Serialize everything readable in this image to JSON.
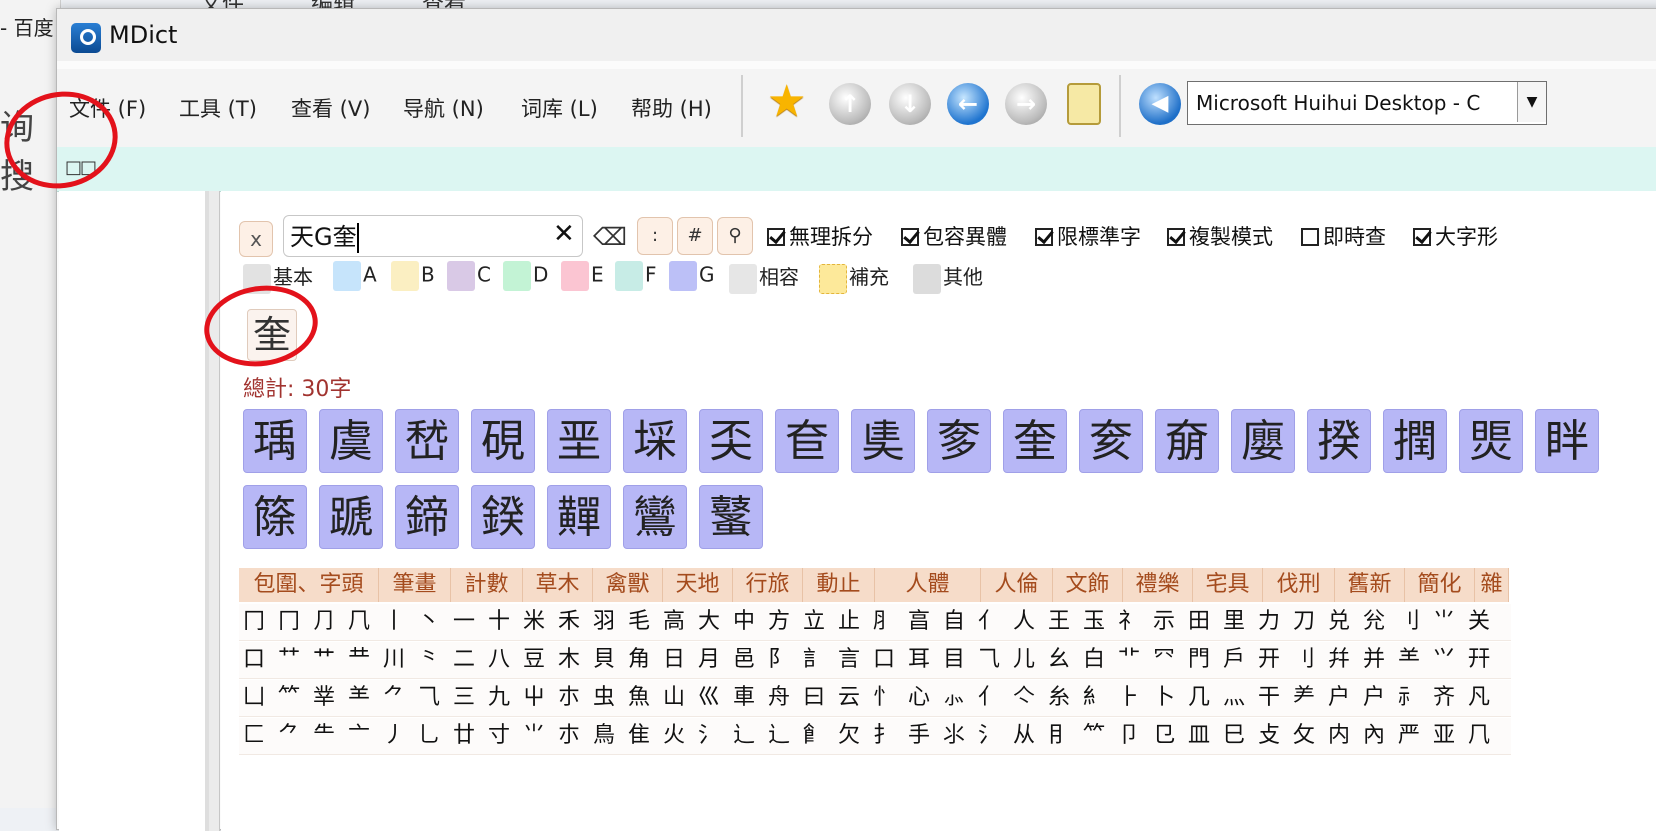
{
  "background": {
    "left_text_1": "- 百度",
    "left_text_2": "询搜",
    "menu": [
      "文件",
      "编辑",
      "查看"
    ]
  },
  "window": {
    "title": "MDict",
    "menu": [
      "文件 (F)",
      "工具 (T)",
      "查看 (V)",
      "导航 (N)",
      "词库 (L)",
      "帮助 (H)"
    ],
    "toolbar": {
      "buttons": [
        "star-icon",
        "up-icon",
        "down-icon",
        "back-icon",
        "forward-icon",
        "clipboard-icon",
        "speaker-icon"
      ],
      "dictionary": "Microsoft Huihui Desktop - C"
    },
    "address": "□□"
  },
  "search": {
    "x_label": "x",
    "query": "天G奎",
    "clear_label": "✕",
    "backspace_label": "⌫",
    "colon_label": ":",
    "hash_label": "#",
    "search_glyph": "⚲",
    "options": [
      {
        "label": "無理拆分",
        "checked": true
      },
      {
        "label": "包容異體",
        "checked": true
      },
      {
        "label": "限標準字",
        "checked": true
      },
      {
        "label": "複製模式",
        "checked": true
      },
      {
        "label": "即時查",
        "checked": false
      },
      {
        "label": "大字形",
        "checked": true
      }
    ]
  },
  "legend": [
    {
      "label": "基本",
      "color": "#e2e2e2"
    },
    {
      "label": "A",
      "color": "#c6e4fb"
    },
    {
      "label": "B",
      "color": "#fbefc2"
    },
    {
      "label": "C",
      "color": "#d9c9e6"
    },
    {
      "label": "D",
      "color": "#c3f3d5"
    },
    {
      "label": "E",
      "color": "#fbc5d2"
    },
    {
      "label": "F",
      "color": "#c7ece6"
    },
    {
      "label": "G",
      "color": "#bcc0f7"
    },
    {
      "label": "相容",
      "color": "#e6e6e6"
    },
    {
      "label": "補充",
      "color": "#fde99a"
    },
    {
      "label": "其他",
      "color": "#dcdcdc"
    }
  ],
  "result_char": "奎",
  "total_label": "總計: 30字",
  "characters_row1": [
    "瑀",
    "虞",
    "嵆",
    "硯",
    "垩",
    "埰",
    "奀",
    "奆",
    "奊",
    "奓",
    "奎",
    "奒",
    "奟",
    "廮",
    "揆",
    "撋",
    "煚",
    "眫"
  ],
  "characters_row2": [
    "篨",
    "蹏",
    "鍗",
    "鍨",
    "䵐",
    "鸞",
    "鼜"
  ],
  "radical_categories": [
    "包圍、字頭",
    "筆畫",
    "計數",
    "草木",
    "禽獸",
    "天地",
    "行旅",
    "動止",
    "人體",
    "人倫",
    "文飾",
    "禮樂",
    "宅具",
    "伐刑",
    "舊新",
    "簡化",
    "雜"
  ],
  "radical_rows": [
    "冂冂⺆⺇丨丶一十米禾羽毛高大中方立止⺼亯自亻人王玉礻示田里力刀兑兊⺉⺌关",
    "口⺿艹龷川⺀二八豆木貝角日月邑阝訁言口耳目⺄儿幺白⻀⺳門戶开刂幷并⺷⺍幵",
    "凵⺮丵⺷⺈⺄三九屮朩虫魚山巛車舟曰云⺖心⺗⺅亽糸糹⺊卜几⺣干⺶户户⺬齐凡",
    "匚⺈⺧亠丿乚廿寸⺌朩鳥隹火⺡⻌辶⻞欠⺘手⺢⺡从⺝⺮卩㔾皿⺒攴攵内內严亚⺇"
  ]
}
